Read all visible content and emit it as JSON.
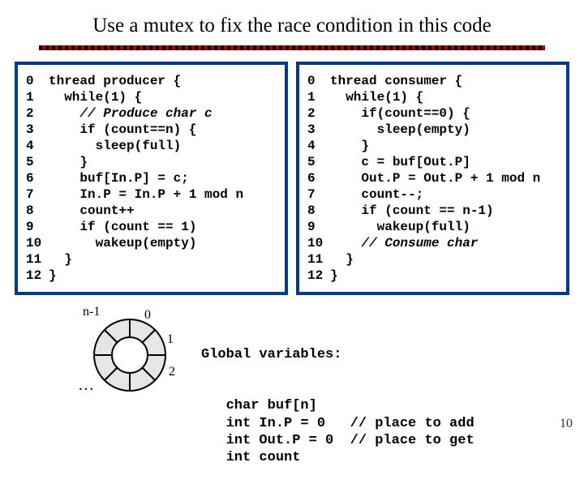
{
  "title": "Use a mutex to fix the race condition in this code",
  "producer": {
    "lines": [
      {
        "n": "0",
        "t": "thread producer {"
      },
      {
        "n": "1",
        "t": "  while(1) {"
      },
      {
        "n": "2",
        "t": "    // Produce char c",
        "c": true
      },
      {
        "n": "3",
        "t": "    if (count==n) {"
      },
      {
        "n": "4",
        "t": "      sleep(full)"
      },
      {
        "n": "5",
        "t": "    }"
      },
      {
        "n": "6",
        "t": "    buf[In.P] = c;"
      },
      {
        "n": "7",
        "t": "    In.P = In.P + 1 mod n"
      },
      {
        "n": "8",
        "t": "    count++"
      },
      {
        "n": "9",
        "t": "    if (count == 1)"
      },
      {
        "n": "10",
        "t": "      wakeup(empty)"
      },
      {
        "n": "11",
        "t": "  }"
      },
      {
        "n": "12",
        "t": "}"
      }
    ]
  },
  "consumer": {
    "lines": [
      {
        "n": "0",
        "t": "thread consumer {"
      },
      {
        "n": "1",
        "t": "  while(1) {"
      },
      {
        "n": "2",
        "t": "    if(count==0) {"
      },
      {
        "n": "3",
        "t": "      sleep(empty)"
      },
      {
        "n": "4",
        "t": "    }"
      },
      {
        "n": "5",
        "t": "    c = buf[Out.P]"
      },
      {
        "n": "6",
        "t": "    Out.P = Out.P + 1 mod n"
      },
      {
        "n": "7",
        "t": "    count--;"
      },
      {
        "n": "8",
        "t": "    if (count == n-1)"
      },
      {
        "n": "9",
        "t": "      wakeup(full)"
      },
      {
        "n": "10",
        "t": "    // Consume char",
        "c": true
      },
      {
        "n": "11",
        "t": "  }"
      },
      {
        "n": "12",
        "t": "}"
      }
    ]
  },
  "ring": {
    "label_top_left": "n-1",
    "label0": "0",
    "label1": "1",
    "label2": "2",
    "ellipsis": "…"
  },
  "globals_header": "Global variables:",
  "globals_lines": [
    "   char buf[n]",
    "   int In.P = 0   // place to add",
    "   int Out.P = 0  // place to get",
    "   int count"
  ],
  "page_number": "10"
}
